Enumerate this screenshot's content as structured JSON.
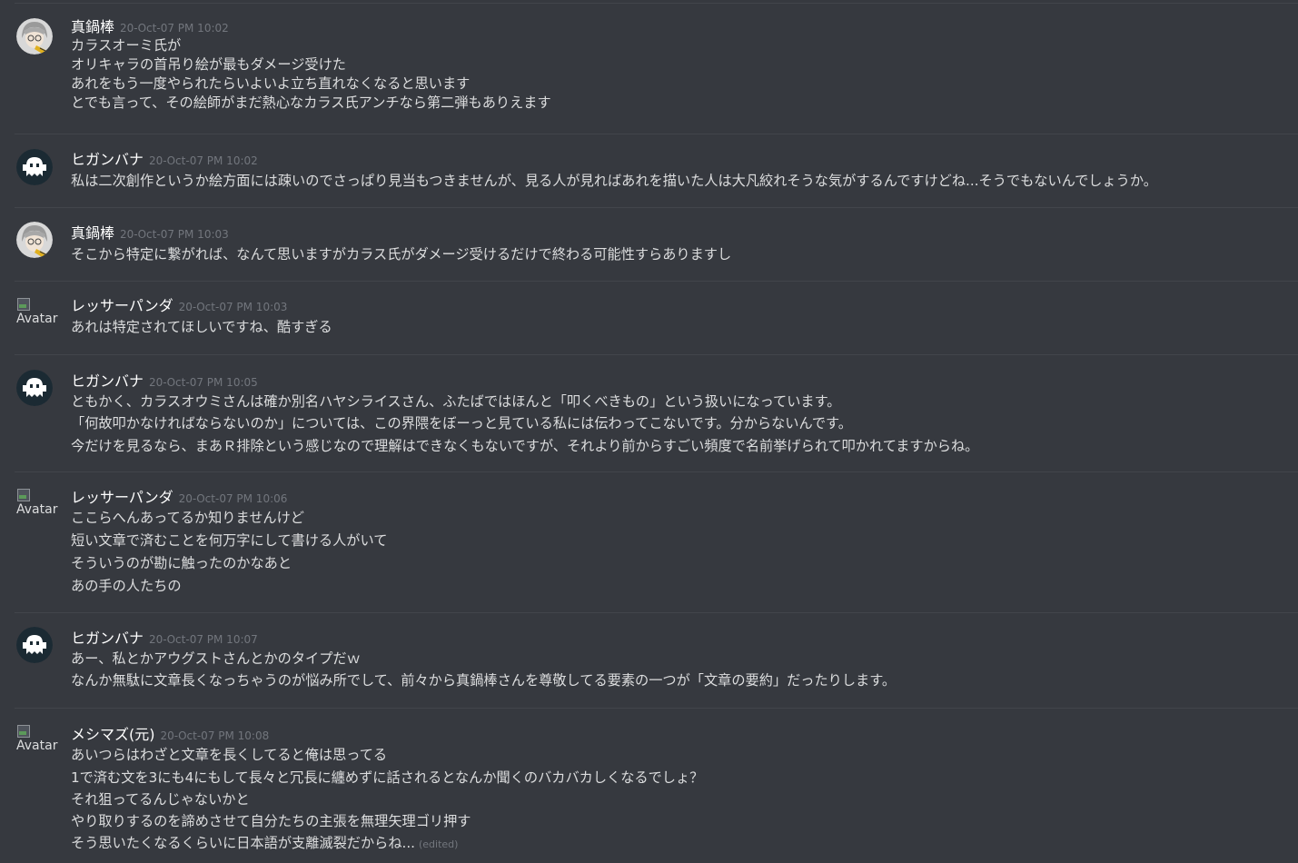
{
  "messages": [
    {
      "author": "真鍋棒",
      "timestamp": "20-Oct-07 PM 10:02",
      "avatar": "manabebou-avatar",
      "lines": [
        "カラスオーミ氏が",
        "オリキャラの首吊り絵が最もダメージ受けた",
        "あれをもう一度やられたらいよいよ立ち直れなくなると思います",
        "とでも言って、その絵師がまだ熱心なカラス氏アンチなら第二弾もありえます"
      ]
    },
    {
      "author": "ヒガンバナ",
      "timestamp": "20-Oct-07 PM 10:02",
      "avatar": "higanbana-avatar",
      "lines": [
        "私は二次創作というか絵方面には疎いのでさっぱり見当もつきませんが、見る人が見ればあれを描いた人は大凡絞れそうな気がするんですけどね...そうでもないんでしょうか。"
      ]
    },
    {
      "author": "真鍋棒",
      "timestamp": "20-Oct-07 PM 10:03",
      "avatar": "manabebou-avatar",
      "lines": [
        "そこから特定に繋がれば、なんて思いますがカラス氏がダメージ受けるだけで終わる可能性すらありますし"
      ]
    },
    {
      "author": "レッサーパンダ",
      "timestamp": "20-Oct-07 PM 10:03",
      "avatar_alt": "Avatar",
      "lines": [
        "あれは特定されてほしいですね、酷すぎる"
      ]
    },
    {
      "author": "ヒガンバナ",
      "timestamp": "20-Oct-07 PM 10:05",
      "avatar": "higanbana-avatar",
      "lines": [
        "ともかく、カラスオウミさんは確か別名ハヤシライスさん、ふたばではほんと「叩くべきもの」という扱いになっています。",
        "「何故叩かなければならないのか」については、この界隈をぼーっと見ている私には伝わってこないです。分からないんです。",
        "今だけを見るなら、まあＲ排除という感じなので理解はできなくもないですが、それより前からすごい頻度で名前挙げられて叩かれてますからね。"
      ]
    },
    {
      "author": "レッサーパンダ",
      "timestamp": "20-Oct-07 PM 10:06",
      "avatar_alt": "Avatar",
      "lines": [
        "ここらへんあってるか知りませんけど",
        "短い文章で済むことを何万字にして書ける人がいて",
        "そういうのが勘に触ったのかなあと",
        "あの手の人たちの"
      ]
    },
    {
      "author": "ヒガンバナ",
      "timestamp": "20-Oct-07 PM 10:07",
      "avatar": "higanbana-avatar",
      "lines": [
        "あー、私とかアウグストさんとかのタイプだｗ",
        "なんか無駄に文章長くなっちゃうのが悩み所でして、前々から真鍋棒さんを尊敬してる要素の一つが「文章の要約」だったりします。"
      ]
    },
    {
      "author": "メシマズ(元)",
      "timestamp": "20-Oct-07 PM 10:08",
      "avatar_alt": "Avatar",
      "lines": [
        "あいつらはわざと文章を長くしてると俺は思ってる",
        "1で済む文を3にも4にもして長々と冗長に纏めずに話されるとなんか聞くのバカバカしくなるでしょ？",
        "それ狙ってるんじゃないかと",
        "やり取りするのを諦めさせて自分たちの主張を無理矢理ゴリ押す",
        "そう思いたくなるくらいに日本語が支離滅裂だからね..."
      ],
      "edited_label": "(edited)"
    }
  ]
}
